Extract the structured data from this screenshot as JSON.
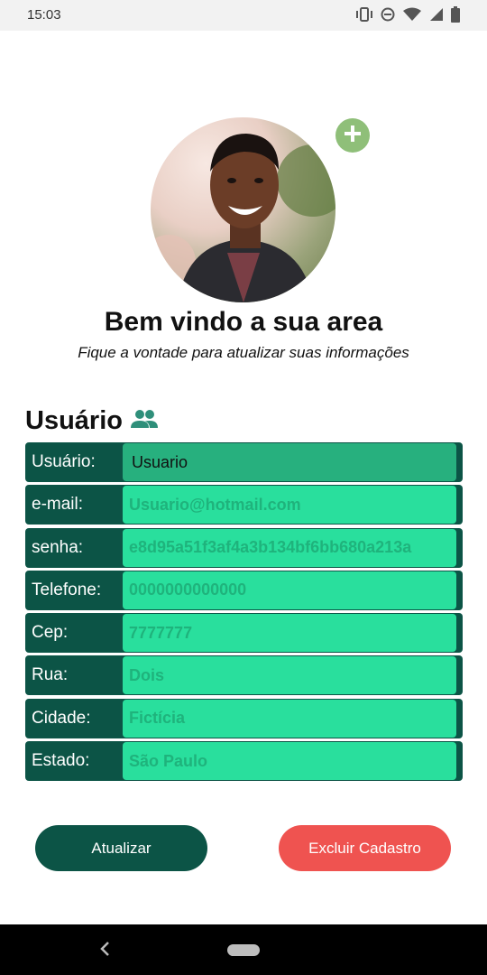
{
  "status_bar": {
    "time": "15:03",
    "icons": [
      "vibrate-icon",
      "dnd-icon",
      "wifi-icon",
      "signal-icon",
      "battery-icon"
    ]
  },
  "profile": {
    "add_photo_icon": "plus-icon",
    "title": "Bem vindo a sua area",
    "subtitle": "Fique a vontade para atualizar suas informações"
  },
  "section": {
    "title": "Usuário",
    "icon": "people-icon"
  },
  "form": {
    "rows": [
      {
        "label": "Usuário:",
        "value": "Usuario",
        "placeholder": ""
      },
      {
        "label": "e-mail:",
        "value": "",
        "placeholder": "Usuario@hotmail.com"
      },
      {
        "label": "senha:",
        "value": "",
        "placeholder": "e8d95a51f3af4a3b134bf6bb680a213a"
      },
      {
        "label": "Telefone:",
        "value": "",
        "placeholder": "0000000000000"
      },
      {
        "label": "Cep:",
        "value": "",
        "placeholder": "7777777"
      },
      {
        "label": "Rua:",
        "value": "",
        "placeholder": "Dois"
      },
      {
        "label": "Cidade:",
        "value": "",
        "placeholder": "Fictícia"
      },
      {
        "label": "Estado:",
        "value": "",
        "placeholder": "São Paulo"
      }
    ]
  },
  "buttons": {
    "update": "Atualizar",
    "delete": "Excluir Cadastro"
  },
  "colors": {
    "dark_green": "#0c5446",
    "field_green": "#29df9d",
    "placeholder_green": "#1fb37c",
    "delete_red": "#ef5350",
    "add_icon_green": "#8fbf79"
  },
  "nav_bar": {
    "back_icon": "back-icon",
    "home_icon": "home-pill-icon"
  }
}
